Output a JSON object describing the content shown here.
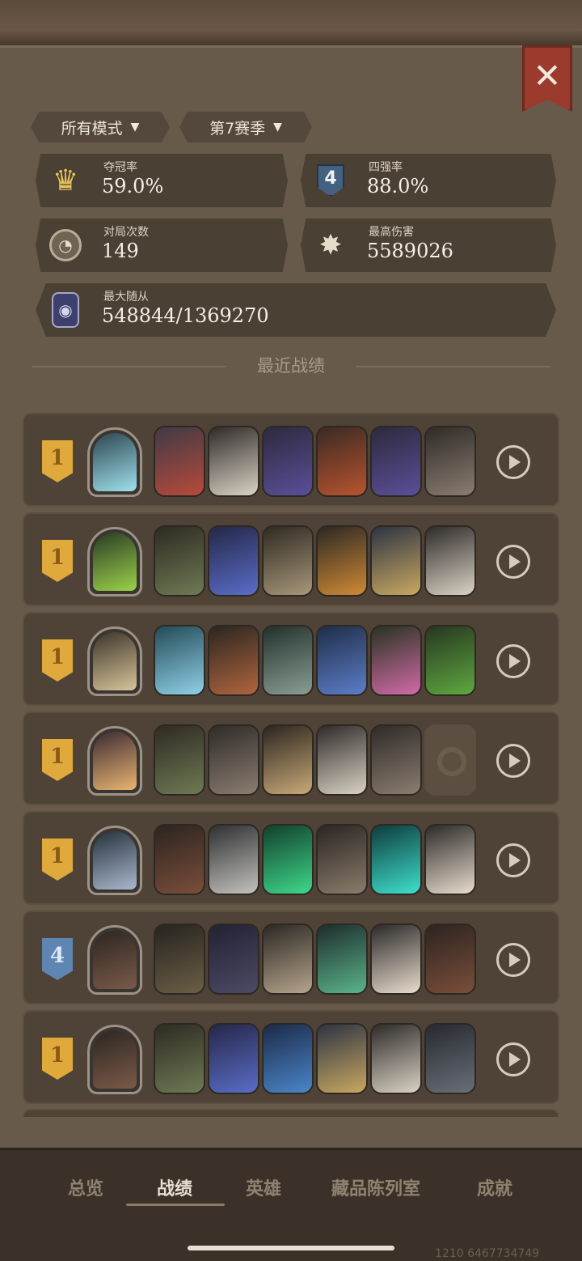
{
  "close_label": "✕",
  "filters": {
    "mode_label": "所有模式",
    "season_label": "第7赛季"
  },
  "stats": {
    "win_rate": {
      "label": "夺冠率",
      "value": "59.0%",
      "icon": "crown-icon"
    },
    "top4_rate": {
      "label": "四强率",
      "value": "88.0%",
      "icon": "rank-4-badge-icon",
      "badge": "4"
    },
    "games": {
      "label": "对局次数",
      "value": "149",
      "icon": "clock-icon"
    },
    "max_damage": {
      "label": "最高伤害",
      "value": "5589026",
      "icon": "burst-icon"
    },
    "max_minion": {
      "label": "最大随从",
      "value": "548844/1369270",
      "icon": "minion-portrait-icon"
    }
  },
  "recent_title": "最近战绩",
  "matches": [
    {
      "rank": "1",
      "rank_color": "gold",
      "hero": "ice-dragon-hero",
      "cards": [
        "goblin-rider",
        "cow-wizard",
        "purple-rat",
        "flame-dragon",
        "purple-rat",
        "rat-bandit"
      ]
    },
    {
      "rank": "1",
      "rank_color": "gold",
      "hero": "green-slime-hero",
      "cards": [
        "bearded-rogue",
        "blue-hair-witch",
        "mummy-beast",
        "pumpkin-head",
        "dwarf-king",
        "cow-wizard"
      ]
    },
    {
      "rank": "1",
      "rank_color": "gold",
      "hero": "old-gardener-hero",
      "cards": [
        "blue-fairy",
        "elf-archer",
        "mushroom-spider",
        "blue-elf-lady",
        "flower-sprite",
        "green-dragon"
      ]
    },
    {
      "rank": "1",
      "rank_color": "gold",
      "hero": "blonde-lady-hero",
      "cards": [
        "bearded-rogue",
        "rat-bandit",
        "golden-eagle",
        "cow-wizard",
        "rat-bandit",
        "empty"
      ]
    },
    {
      "rank": "1",
      "rank_color": "gold",
      "hero": "undead-queen-hero",
      "cards": [
        "armored-ape",
        "silver-knight",
        "green-spirit",
        "music-box",
        "cyan-golem",
        "pig-scientist"
      ]
    },
    {
      "rank": "4",
      "rank_color": "blue",
      "hero": "goblin-gang-hero",
      "cards": [
        "steam-robot",
        "shadow-cat",
        "old-scribe",
        "shark-mage",
        "pig-scientist",
        "armored-ape"
      ]
    },
    {
      "rank": "1",
      "rank_color": "gold",
      "hero": "goblin-gang-hero",
      "cards": [
        "bearded-rogue",
        "blue-hair-witch",
        "blue-whale",
        "dwarf-king",
        "cow-wizard",
        "sumo-boar"
      ]
    }
  ],
  "nav": {
    "overview": "总览",
    "records": "战绩",
    "heroes": "英雄",
    "collection": "藏品陈列室",
    "achievements": "成就"
  },
  "watermark": "1210 6467734749",
  "colors": {
    "panel": "#675a4b",
    "rank_gold": "#e0a93c",
    "rank_blue": "#5f86b3",
    "close": "#9b3b2e"
  }
}
